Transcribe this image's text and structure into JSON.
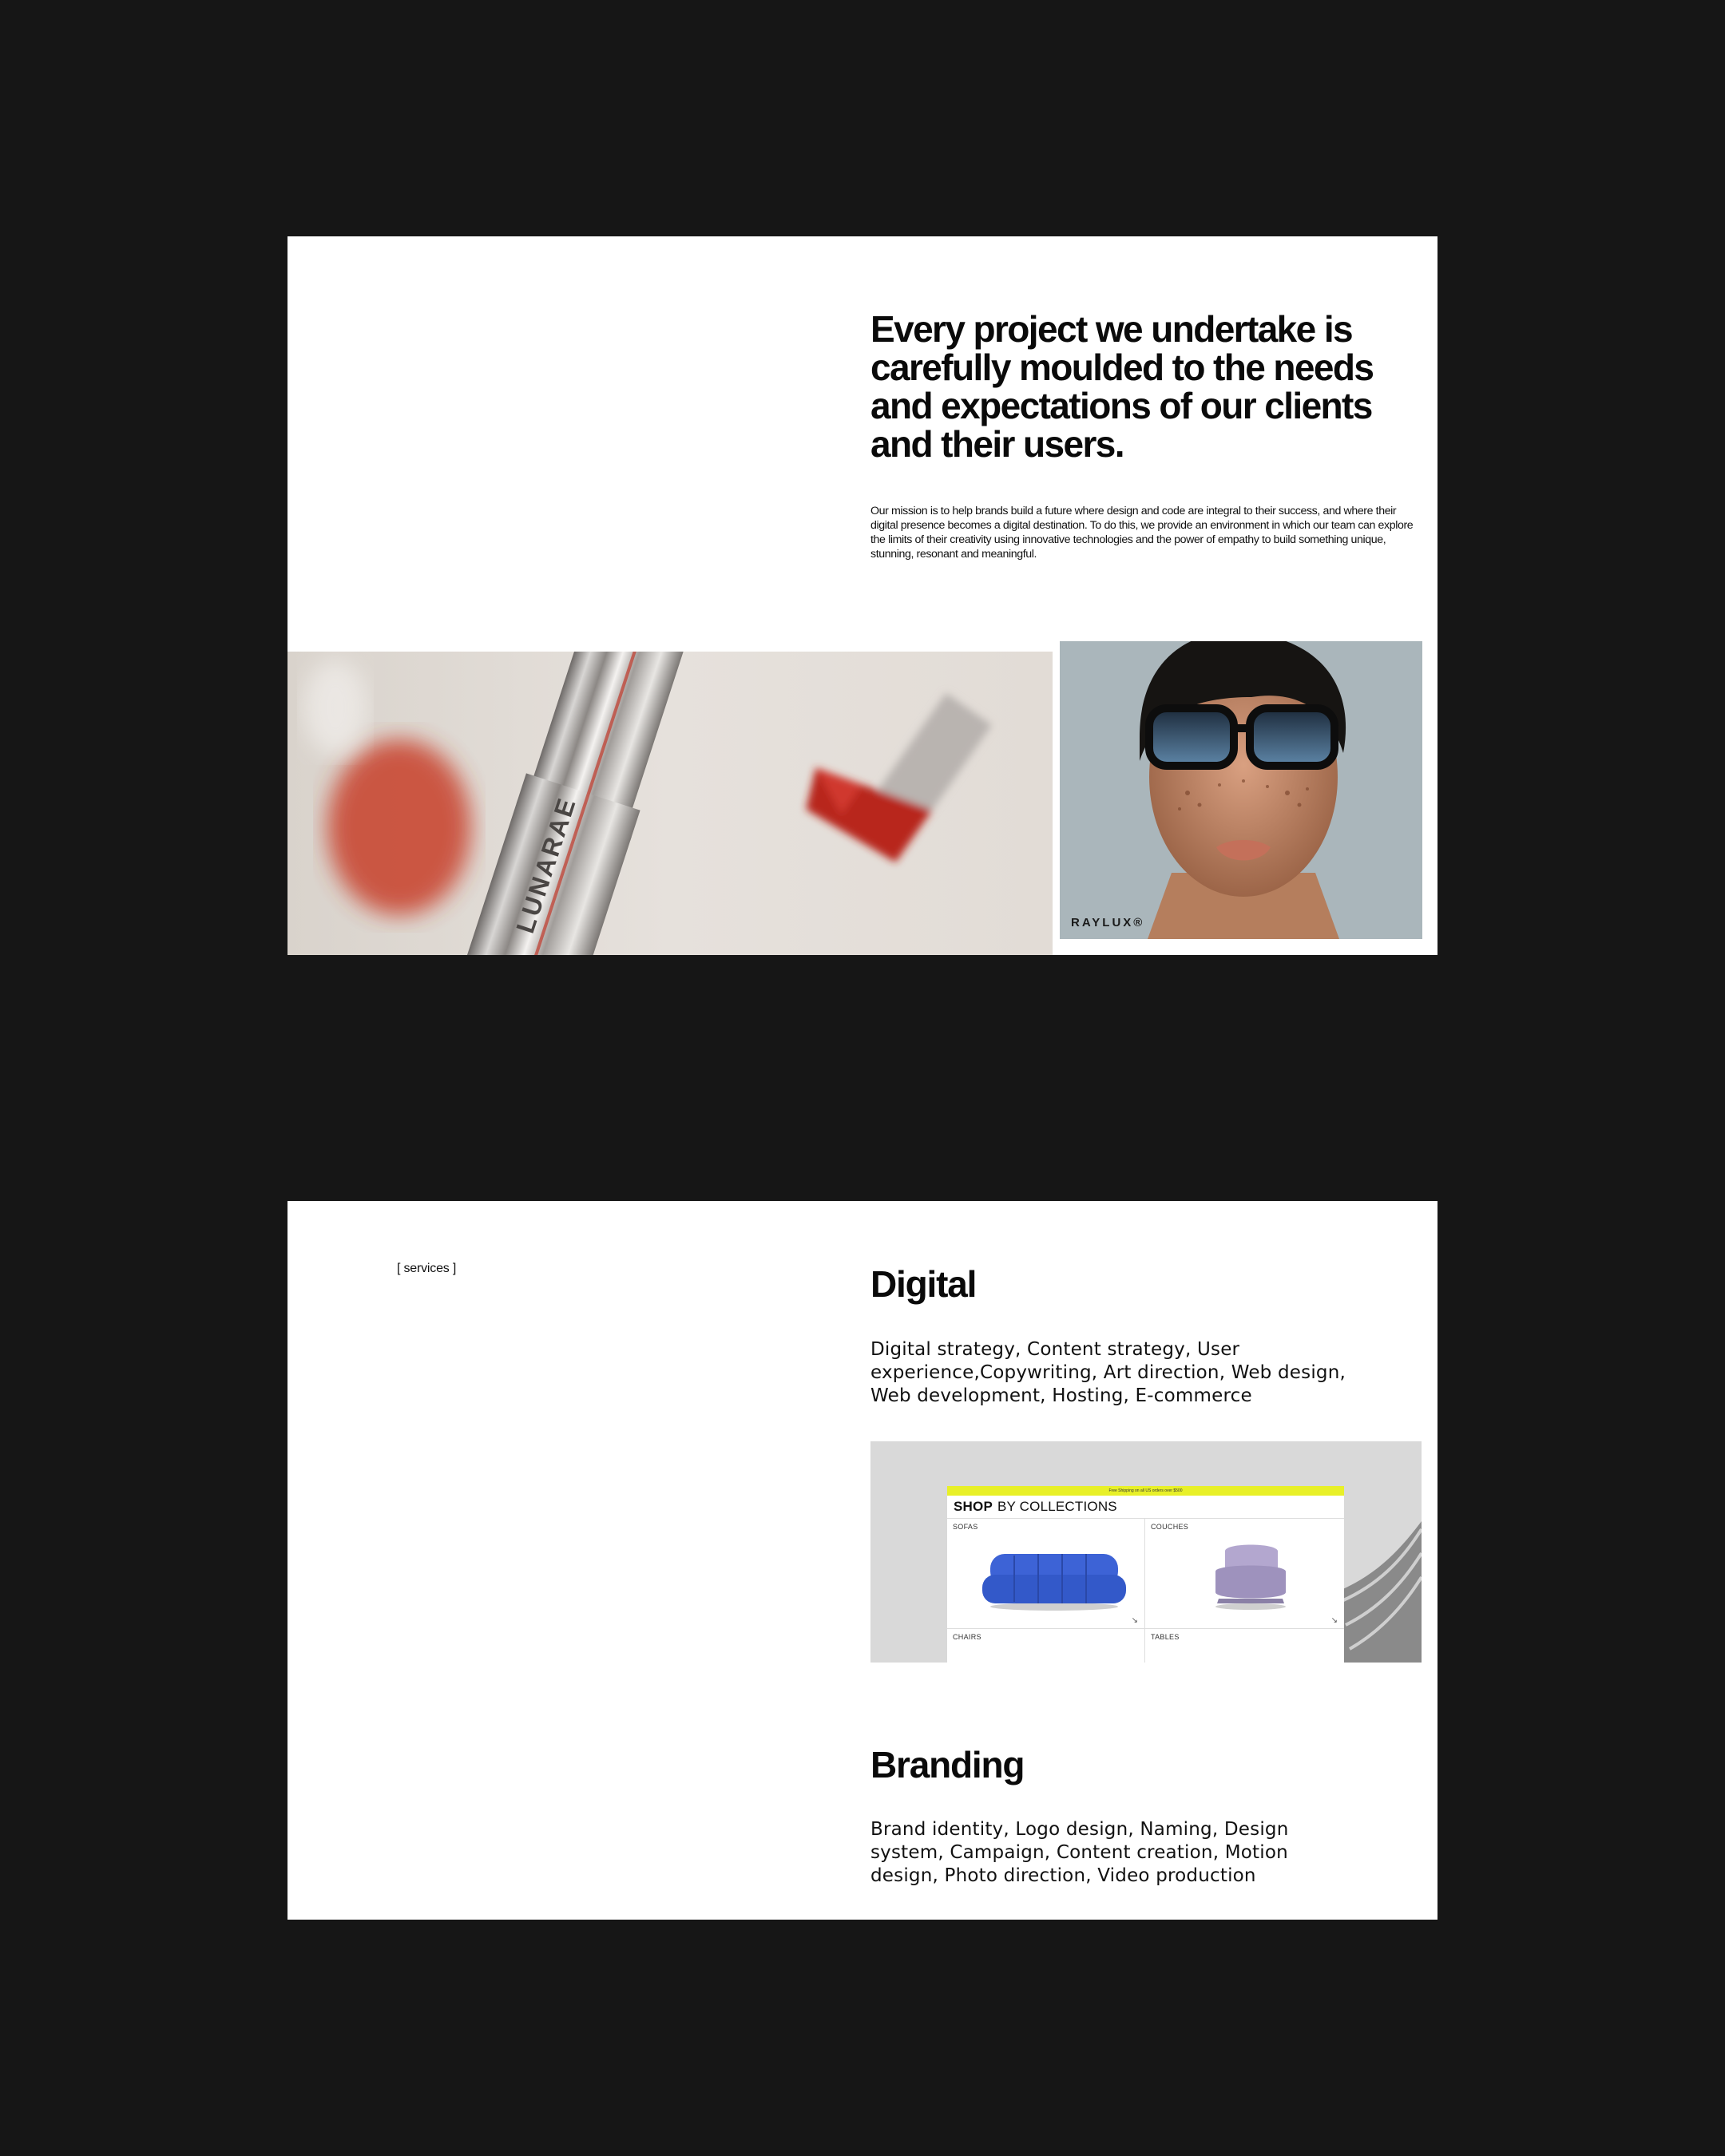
{
  "intro": {
    "headline": "Every project we undertake is carefully moulded to the needs and expectations of our clients and their users.",
    "mission": "Our mission is to help brands build a future where design and code are integral to their success, and where their digital presence becomes a digital destination. To do this, we provide an environment in which our team can explore the limits of their creativity using innovative technologies and the power of empathy to build something unique, stunning, resonant and meaningful."
  },
  "gallery": {
    "lipstick_brand": "LUNARAE",
    "portrait_brand": "RAYLUX®"
  },
  "services": {
    "tag": "[ services ]",
    "items": [
      {
        "title": "Digital",
        "list": "Digital strategy, Content strategy, User experience,Copywriting, Art direction, Web design, Web development, Hosting, E-commerce"
      },
      {
        "title": "Branding",
        "list": "Brand identity, Logo design, Naming, Design system, Campaign, Content creation, Motion design, Photo direction, Video production"
      }
    ],
    "shop_mock": {
      "topbar": "Free Shipping on all US orders over $500",
      "heading_bold": "SHOP",
      "heading_rest": "BY COLLECTIONS",
      "categories": [
        "SOFAS",
        "COUCHES",
        "CHAIRS",
        "TABLES"
      ],
      "arrow": "↘"
    }
  },
  "colors": {
    "page_bg": "#161616",
    "card_bg": "#ffffff",
    "accent_yellow": "#e8f028",
    "sofa_blue": "#3d63d6",
    "lipstick_red": "#b8261c"
  }
}
